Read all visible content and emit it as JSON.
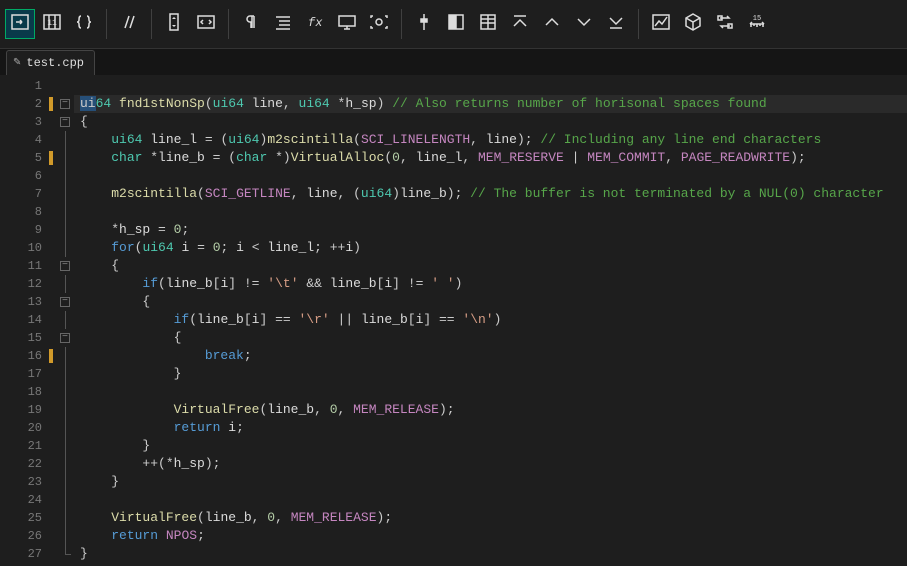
{
  "tabs": {
    "active": {
      "label": "test.cpp",
      "dirty_indicator": "●"
    }
  },
  "toolbar": {
    "icons": [
      "arrow-right-bar",
      "columns",
      "braces-link",
      "sep",
      "double-slash",
      "sep",
      "scroll-vert",
      "code-brackets",
      "sep",
      "pilcrow",
      "indent-lines",
      "fx",
      "screen",
      "target",
      "sep",
      "slider-vert",
      "grid-half",
      "grid-right",
      "caret-up-bar",
      "caret-up",
      "caret-down",
      "caret-down-bar",
      "sep",
      "chart",
      "dice",
      "swap",
      "ruler-15"
    ]
  },
  "editor": {
    "highlighted_line": 2,
    "lines": [
      {
        "n": 1,
        "marker": "",
        "fold": "",
        "tokens": []
      },
      {
        "n": 2,
        "marker": "changed",
        "fold": "boxminus",
        "tokens": [
          [
            "sel",
            "ui"
          ],
          [
            "t",
            "64"
          ],
          [
            "p",
            " "
          ],
          [
            "fn",
            "fnd1stNonSp"
          ],
          [
            "p",
            "("
          ],
          [
            "t",
            "ui64"
          ],
          [
            "p",
            " "
          ],
          [
            "id",
            "line"
          ],
          [
            "p",
            ", "
          ],
          [
            "t",
            "ui64"
          ],
          [
            "p",
            " *"
          ],
          [
            "id",
            "h_sp"
          ],
          [
            "p",
            ") "
          ],
          [
            "c",
            "// Also returns number of horisonal spaces found"
          ]
        ]
      },
      {
        "n": 3,
        "marker": "",
        "fold": "boxminus",
        "tokens": [
          [
            "p",
            "{"
          ]
        ]
      },
      {
        "n": 4,
        "marker": "",
        "fold": "line",
        "tokens": [
          [
            "p",
            "    "
          ],
          [
            "t",
            "ui64"
          ],
          [
            "p",
            " "
          ],
          [
            "id",
            "line_l"
          ],
          [
            "p",
            " = ("
          ],
          [
            "t",
            "ui64"
          ],
          [
            "p",
            ")"
          ],
          [
            "fn",
            "m2scintilla"
          ],
          [
            "p",
            "("
          ],
          [
            "m",
            "SCI_LINELENGTH"
          ],
          [
            "p",
            ", "
          ],
          [
            "id",
            "line"
          ],
          [
            "p",
            "); "
          ],
          [
            "c",
            "// Including any line end characters"
          ]
        ]
      },
      {
        "n": 5,
        "marker": "changed",
        "fold": "line",
        "tokens": [
          [
            "p",
            "    "
          ],
          [
            "t",
            "char"
          ],
          [
            "p",
            " *"
          ],
          [
            "id",
            "line_b"
          ],
          [
            "p",
            " = ("
          ],
          [
            "t",
            "char"
          ],
          [
            "p",
            " *)"
          ],
          [
            "fn",
            "VirtualAlloc"
          ],
          [
            "p",
            "("
          ],
          [
            "n",
            "0"
          ],
          [
            "p",
            ", "
          ],
          [
            "id",
            "line_l"
          ],
          [
            "p",
            ", "
          ],
          [
            "m",
            "MEM_RESERVE"
          ],
          [
            "p",
            " | "
          ],
          [
            "m",
            "MEM_COMMIT"
          ],
          [
            "p",
            ", "
          ],
          [
            "m",
            "PAGE_READWRITE"
          ],
          [
            "p",
            ");"
          ]
        ]
      },
      {
        "n": 6,
        "marker": "",
        "fold": "line",
        "tokens": []
      },
      {
        "n": 7,
        "marker": "",
        "fold": "line",
        "tokens": [
          [
            "p",
            "    "
          ],
          [
            "fn",
            "m2scintilla"
          ],
          [
            "p",
            "("
          ],
          [
            "m",
            "SCI_GETLINE"
          ],
          [
            "p",
            ", "
          ],
          [
            "id",
            "line"
          ],
          [
            "p",
            ", ("
          ],
          [
            "t",
            "ui64"
          ],
          [
            "p",
            ")"
          ],
          [
            "id",
            "line_b"
          ],
          [
            "p",
            "); "
          ],
          [
            "c",
            "// The buffer is not terminated by a NUL(0) character"
          ]
        ]
      },
      {
        "n": 8,
        "marker": "",
        "fold": "line",
        "tokens": []
      },
      {
        "n": 9,
        "marker": "",
        "fold": "line",
        "tokens": [
          [
            "p",
            "    *"
          ],
          [
            "id",
            "h_sp"
          ],
          [
            "p",
            " = "
          ],
          [
            "n",
            "0"
          ],
          [
            "p",
            ";"
          ]
        ]
      },
      {
        "n": 10,
        "marker": "",
        "fold": "line",
        "tokens": [
          [
            "p",
            "    "
          ],
          [
            "k",
            "for"
          ],
          [
            "p",
            "("
          ],
          [
            "t",
            "ui64"
          ],
          [
            "p",
            " "
          ],
          [
            "id",
            "i"
          ],
          [
            "p",
            " = "
          ],
          [
            "n",
            "0"
          ],
          [
            "p",
            "; "
          ],
          [
            "id",
            "i"
          ],
          [
            "p",
            " < "
          ],
          [
            "id",
            "line_l"
          ],
          [
            "p",
            "; ++"
          ],
          [
            "id",
            "i"
          ],
          [
            "p",
            ")"
          ]
        ]
      },
      {
        "n": 11,
        "marker": "",
        "fold": "boxminus",
        "tokens": [
          [
            "p",
            "    {"
          ]
        ]
      },
      {
        "n": 12,
        "marker": "",
        "fold": "line",
        "tokens": [
          [
            "p",
            "        "
          ],
          [
            "k",
            "if"
          ],
          [
            "p",
            "("
          ],
          [
            "id",
            "line_b"
          ],
          [
            "p",
            "["
          ],
          [
            "id",
            "i"
          ],
          [
            "p",
            "] != "
          ],
          [
            "s",
            "'\\t'"
          ],
          [
            "p",
            " && "
          ],
          [
            "id",
            "line_b"
          ],
          [
            "p",
            "["
          ],
          [
            "id",
            "i"
          ],
          [
            "p",
            "] != "
          ],
          [
            "s",
            "' '"
          ],
          [
            "p",
            ")"
          ]
        ]
      },
      {
        "n": 13,
        "marker": "",
        "fold": "boxminus",
        "tokens": [
          [
            "p",
            "        {"
          ]
        ]
      },
      {
        "n": 14,
        "marker": "",
        "fold": "line",
        "tokens": [
          [
            "p",
            "            "
          ],
          [
            "k",
            "if"
          ],
          [
            "p",
            "("
          ],
          [
            "id",
            "line_b"
          ],
          [
            "p",
            "["
          ],
          [
            "id",
            "i"
          ],
          [
            "p",
            "] == "
          ],
          [
            "s",
            "'\\r'"
          ],
          [
            "p",
            " || "
          ],
          [
            "id",
            "line_b"
          ],
          [
            "p",
            "["
          ],
          [
            "id",
            "i"
          ],
          [
            "p",
            "] == "
          ],
          [
            "s",
            "'\\n'"
          ],
          [
            "p",
            ")"
          ]
        ]
      },
      {
        "n": 15,
        "marker": "",
        "fold": "boxminus",
        "tokens": [
          [
            "p",
            "            {"
          ]
        ]
      },
      {
        "n": 16,
        "marker": "changed",
        "fold": "line",
        "tokens": [
          [
            "p",
            "                "
          ],
          [
            "k",
            "break"
          ],
          [
            "p",
            ";"
          ]
        ]
      },
      {
        "n": 17,
        "marker": "",
        "fold": "line",
        "tokens": [
          [
            "p",
            "            }"
          ]
        ]
      },
      {
        "n": 18,
        "marker": "",
        "fold": "line",
        "tokens": []
      },
      {
        "n": 19,
        "marker": "",
        "fold": "line",
        "tokens": [
          [
            "p",
            "            "
          ],
          [
            "fn",
            "VirtualFree"
          ],
          [
            "p",
            "("
          ],
          [
            "id",
            "line_b"
          ],
          [
            "p",
            ", "
          ],
          [
            "n",
            "0"
          ],
          [
            "p",
            ", "
          ],
          [
            "m",
            "MEM_RELEASE"
          ],
          [
            "p",
            ");"
          ]
        ]
      },
      {
        "n": 20,
        "marker": "",
        "fold": "line",
        "tokens": [
          [
            "p",
            "            "
          ],
          [
            "k",
            "return"
          ],
          [
            "p",
            " "
          ],
          [
            "id",
            "i"
          ],
          [
            "p",
            ";"
          ]
        ]
      },
      {
        "n": 21,
        "marker": "",
        "fold": "line",
        "tokens": [
          [
            "p",
            "        }"
          ]
        ]
      },
      {
        "n": 22,
        "marker": "",
        "fold": "line",
        "tokens": [
          [
            "p",
            "        ++(*"
          ],
          [
            "id",
            "h_sp"
          ],
          [
            "p",
            ");"
          ]
        ]
      },
      {
        "n": 23,
        "marker": "",
        "fold": "line",
        "tokens": [
          [
            "p",
            "    }"
          ]
        ]
      },
      {
        "n": 24,
        "marker": "",
        "fold": "line",
        "tokens": []
      },
      {
        "n": 25,
        "marker": "",
        "fold": "line",
        "tokens": [
          [
            "p",
            "    "
          ],
          [
            "fn",
            "VirtualFree"
          ],
          [
            "p",
            "("
          ],
          [
            "id",
            "line_b"
          ],
          [
            "p",
            ", "
          ],
          [
            "n",
            "0"
          ],
          [
            "p",
            ", "
          ],
          [
            "m",
            "MEM_RELEASE"
          ],
          [
            "p",
            ");"
          ]
        ]
      },
      {
        "n": 26,
        "marker": "",
        "fold": "line",
        "tokens": [
          [
            "p",
            "    "
          ],
          [
            "k",
            "return"
          ],
          [
            "p",
            " "
          ],
          [
            "m",
            "NPOS"
          ],
          [
            "p",
            ";"
          ]
        ]
      },
      {
        "n": 27,
        "marker": "",
        "fold": "corner",
        "tokens": [
          [
            "p",
            "}"
          ]
        ]
      }
    ]
  }
}
